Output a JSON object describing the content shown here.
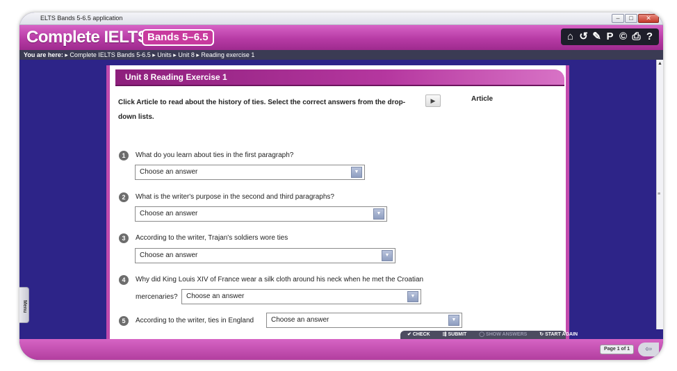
{
  "window": {
    "title": "ELTS Bands 5-6.5 application"
  },
  "header": {
    "brand": "Complete IELTS",
    "band_badge": "Bands 5–6.5",
    "toolbar_icons": [
      "home-icon",
      "back-icon",
      "tools-icon",
      "p-icon",
      "copyright-icon",
      "print-icon",
      "help-icon"
    ]
  },
  "breadcrumb": {
    "prefix": "You are here:",
    "trail": "▸ Complete IELTS Bands 5-6.5 ▸ Units ▸ Unit 8 ▸ Reading exercise 1"
  },
  "exercise": {
    "title": "Unit 8 Reading Exercise 1",
    "instruction_line1": "Click Article to read about the history of ties. Select the correct answers from the drop-",
    "instruction_line2": "down lists.",
    "article_label": "Article",
    "placeholder": "Choose an answer",
    "questions": [
      {
        "num": "1",
        "text": "What do you learn about ties in the first paragraph?"
      },
      {
        "num": "2",
        "text": "What is the writer's purpose in the second and third paragraphs?"
      },
      {
        "num": "3",
        "text": "According to the writer, Trajan's soldiers wore ties"
      },
      {
        "num": "4",
        "text": "Why did King Louis XIV of France wear a silk cloth around his neck when he met the Croatian",
        "text2": "mercenaries?"
      },
      {
        "num": "5",
        "text": "According to the writer, ties in England"
      }
    ]
  },
  "actions": {
    "check": "CHECK",
    "submit": "SUBMIT",
    "show_answers": "SHOW ANSWERS",
    "start_again": "START AGAIN"
  },
  "sidebar": {
    "menu_label": "Menu"
  },
  "footer": {
    "page_indicator": "Page 1 of 1"
  }
}
